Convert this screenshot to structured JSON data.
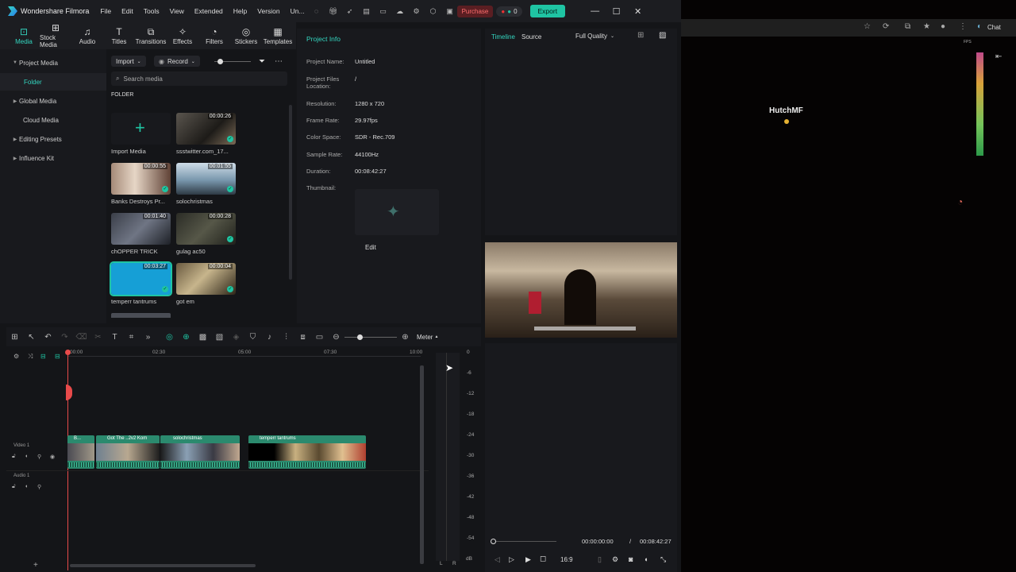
{
  "app": {
    "name": "Wondershare Filmora",
    "title_short": "Un...",
    "purchase": "Purchase",
    "export": "Export",
    "badge_count": "0"
  },
  "menus": [
    "File",
    "Edit",
    "Tools",
    "View",
    "Extended",
    "Help",
    "Version"
  ],
  "toolbar": [
    {
      "label": "Media",
      "icon": "media-icon"
    },
    {
      "label": "Stock Media",
      "icon": "stock-media-icon"
    },
    {
      "label": "Audio",
      "icon": "audio-icon"
    },
    {
      "label": "Titles",
      "icon": "titles-icon"
    },
    {
      "label": "Transitions",
      "icon": "transitions-icon"
    },
    {
      "label": "Effects",
      "icon": "effects-icon"
    },
    {
      "label": "Filters",
      "icon": "filters-icon"
    },
    {
      "label": "Stickers",
      "icon": "stickers-icon"
    },
    {
      "label": "Templates",
      "icon": "templates-icon"
    }
  ],
  "sidebar": {
    "items": [
      {
        "label": "Project Media",
        "expanded": true
      },
      {
        "label": "Folder"
      },
      {
        "label": "Global Media"
      },
      {
        "label": "Cloud Media"
      },
      {
        "label": "Editing Presets"
      },
      {
        "label": "Influence Kit"
      }
    ]
  },
  "media": {
    "import": "Import",
    "record": "Record",
    "search_placeholder": "Search media",
    "folder_label": "FOLDER",
    "import_media": "Import Media",
    "items": [
      {
        "name": "Import Media"
      },
      {
        "name": "ssstwitter.com_17...",
        "duration": "00:00:26"
      },
      {
        "name": "Banks Destroys Pr...",
        "duration": "00:00:55"
      },
      {
        "name": "solochristmas",
        "duration": "00:01:55"
      },
      {
        "name": "chOPPER TRICK",
        "duration": "00:01:40"
      },
      {
        "name": "gulag ac50",
        "duration": "00:00:28"
      },
      {
        "name": "temperr tantrums",
        "duration": "00:03:27"
      },
      {
        "name": "got em",
        "duration": "00:00:04"
      }
    ]
  },
  "project_info": {
    "heading": "Project Info",
    "rows": [
      {
        "label": "Project Name:",
        "value": "Untitled"
      },
      {
        "label": "Project Files Location:",
        "value": "/"
      },
      {
        "label": "Resolution:",
        "value": "1280 x 720"
      },
      {
        "label": "Frame Rate:",
        "value": "29.97fps"
      },
      {
        "label": "Color Space:",
        "value": "SDR - Rec.709"
      },
      {
        "label": "Sample Rate:",
        "value": "44100Hz"
      },
      {
        "label": "Duration:",
        "value": "00:08:42:27"
      }
    ],
    "thumbnail_label": "Thumbnail:",
    "edit": "Edit"
  },
  "preview": {
    "tab_timeline": "Timeline",
    "tab_source": "Source",
    "quality": "Full Quality",
    "current": "00:00:00:00",
    "separator": "/",
    "total": "00:08:42:27",
    "ratio": "16:9"
  },
  "timeline": {
    "meter_label": "Meter",
    "ruler": [
      "00:00",
      "02:30",
      "05:00",
      "07:30",
      "10:00"
    ],
    "video_track": "Video 1",
    "audio_track": "Audio 1",
    "clips": [
      "B...",
      "Got The ..2v2 Kom",
      "solochristmas",
      "temperr tantrums"
    ],
    "db": [
      "0",
      "-6",
      "-12",
      "-18",
      "-24",
      "-30",
      "-36",
      "-42",
      "-48",
      "-54",
      "dB"
    ],
    "lr": [
      "L",
      "R"
    ]
  },
  "external": {
    "username": "HutchMF",
    "chat": "Chat",
    "fps": "FPS"
  }
}
